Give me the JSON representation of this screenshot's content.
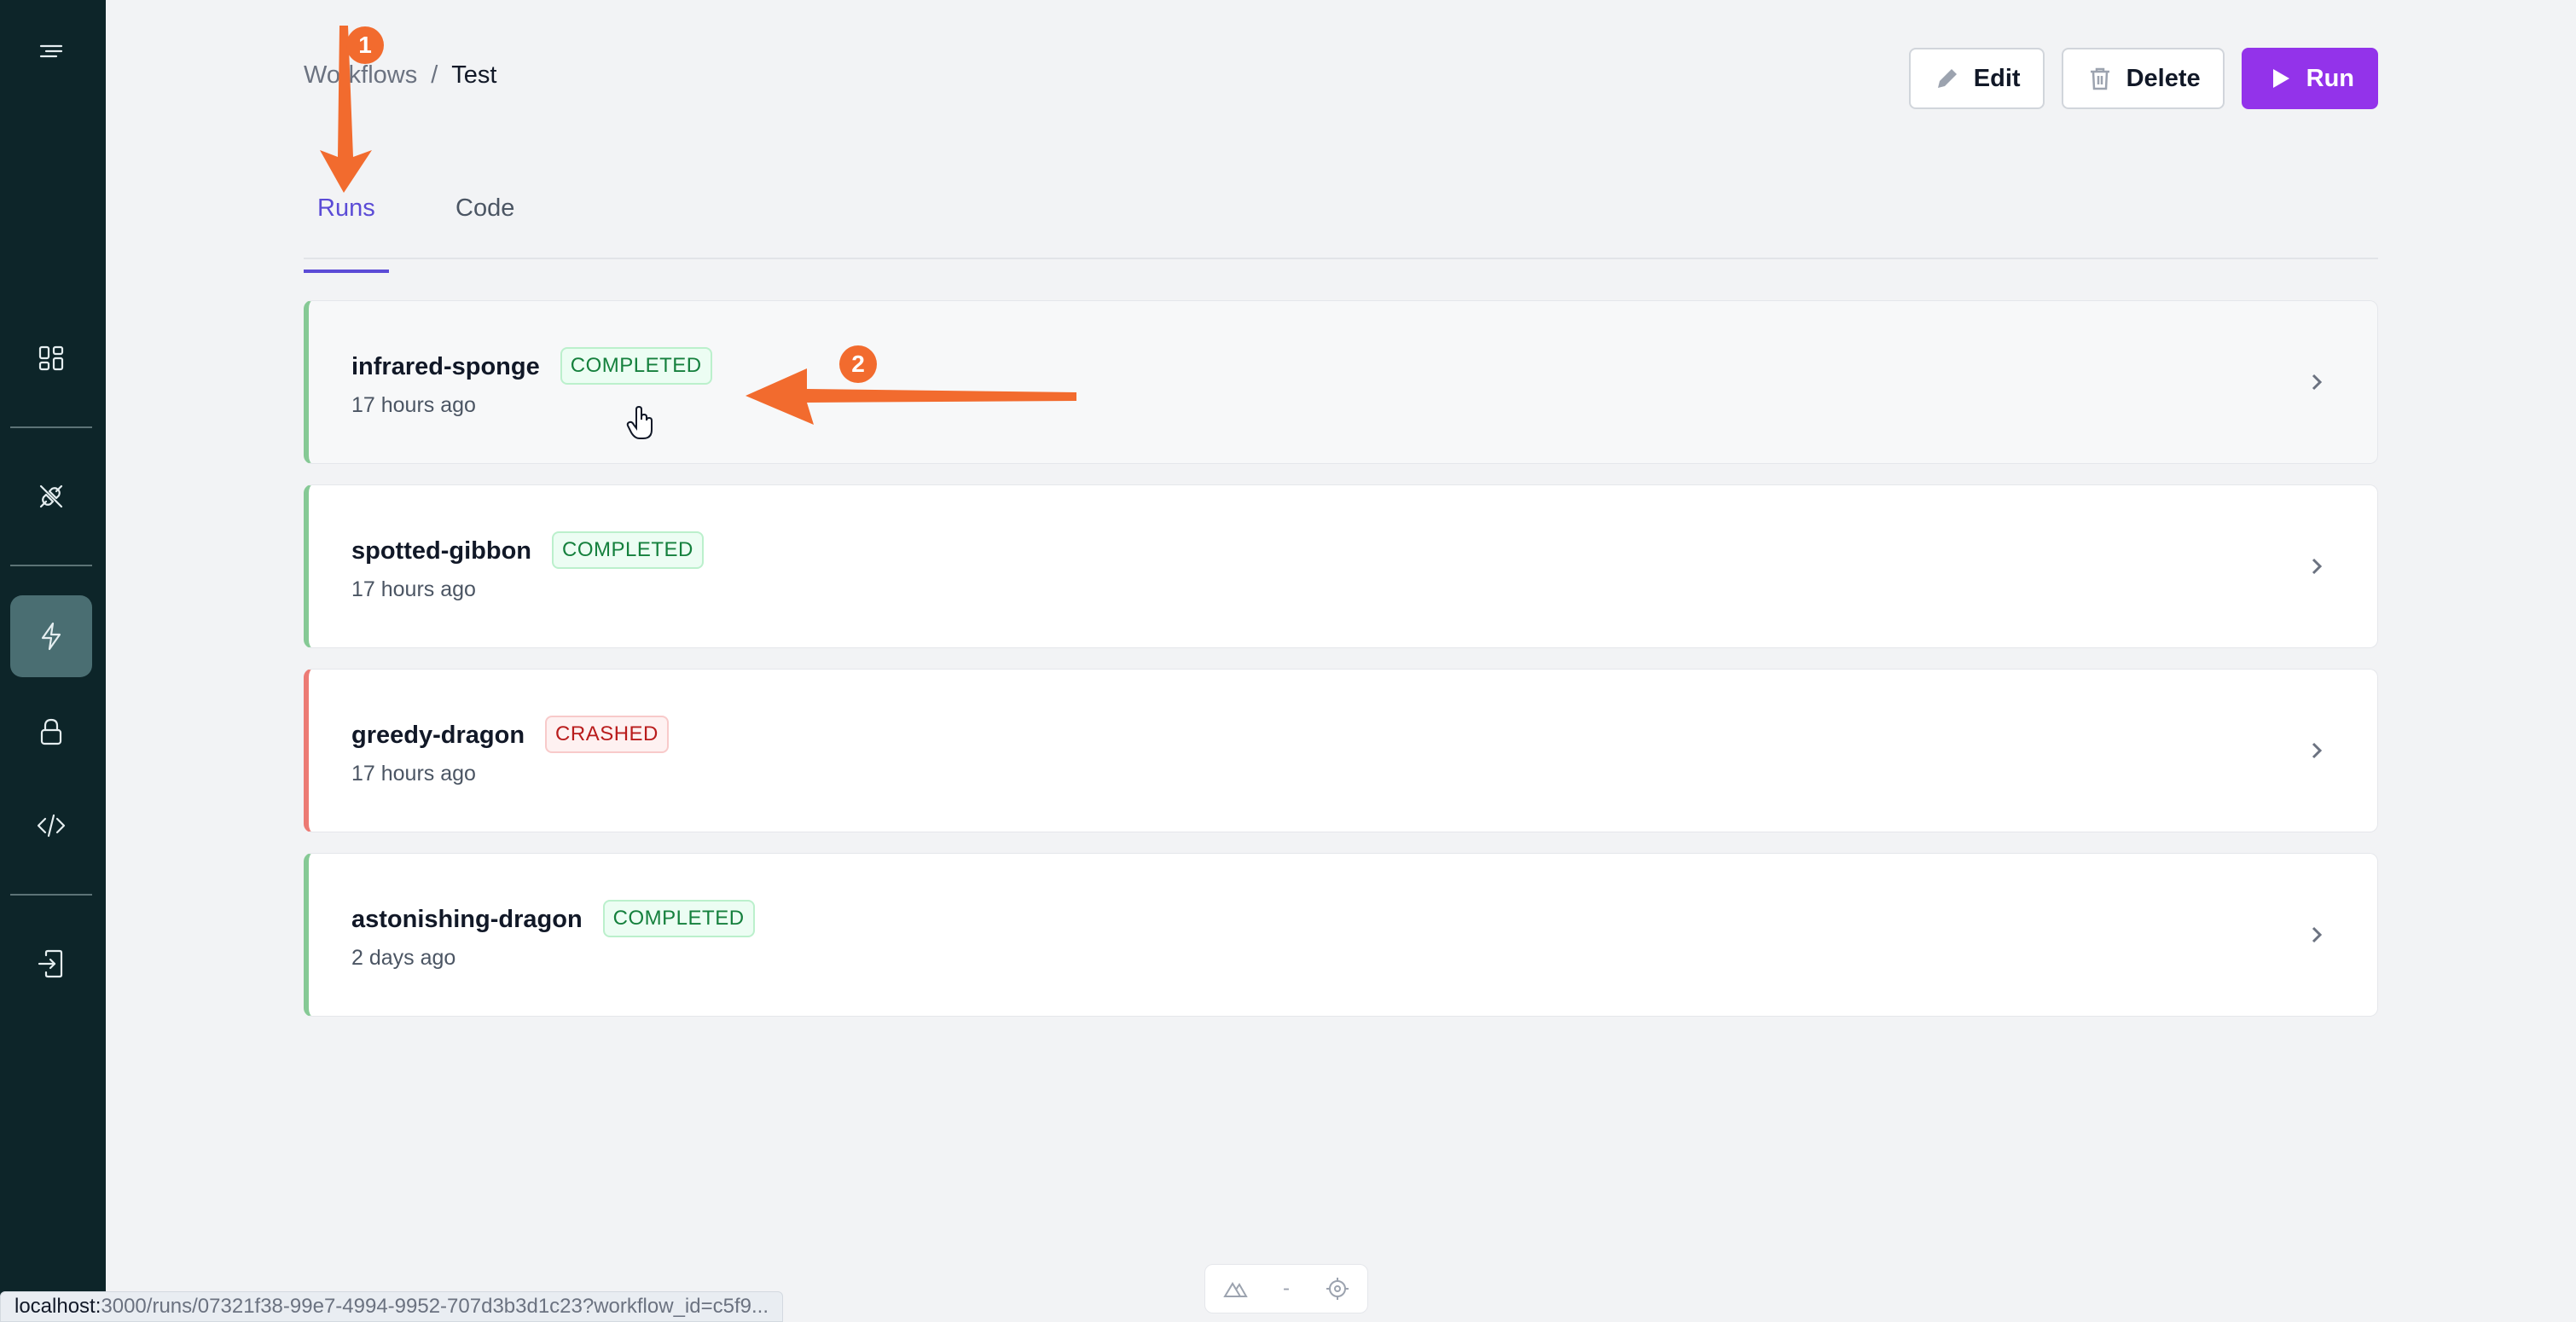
{
  "sidebar": {
    "items": [
      {
        "name": "menu-icon"
      },
      {
        "name": "dashboard-icon"
      },
      {
        "name": "plug-icon"
      },
      {
        "name": "lightning-icon",
        "active": true
      },
      {
        "name": "lock-icon"
      },
      {
        "name": "code-icon"
      },
      {
        "name": "logout-icon"
      }
    ]
  },
  "header": {
    "breadcrumb": [
      "Workflows",
      "Test"
    ],
    "separator": "/",
    "actions": {
      "edit_label": "Edit",
      "delete_label": "Delete",
      "run_label": "Run"
    }
  },
  "tabs": [
    {
      "label": "Runs",
      "active": true
    },
    {
      "label": "Code",
      "active": false
    }
  ],
  "runs": [
    {
      "name": "infrared-sponge",
      "status": "COMPLETED",
      "time": "17 hours ago"
    },
    {
      "name": "spotted-gibbon",
      "status": "COMPLETED",
      "time": "17 hours ago"
    },
    {
      "name": "greedy-dragon",
      "status": "CRASHED",
      "time": "17 hours ago"
    },
    {
      "name": "astonishing-dragon",
      "status": "COMPLETED",
      "time": "2 days ago"
    }
  ],
  "annotations": {
    "step1": "1",
    "step2": "2"
  },
  "statusbar": {
    "host": "localhost:",
    "rest": "3000/runs/07321f38-99e7-4994-9952-707d3b3d1c23?workflow_id=c5f9..."
  },
  "devtools": {
    "separator": "-"
  },
  "colors": {
    "sidebar_bg": "#0d2529",
    "accent": "#9333ea",
    "tab_active": "#5b4bd6",
    "completed": "#15803d",
    "crashed": "#b91c1c",
    "annotation": "#f26b2e"
  }
}
